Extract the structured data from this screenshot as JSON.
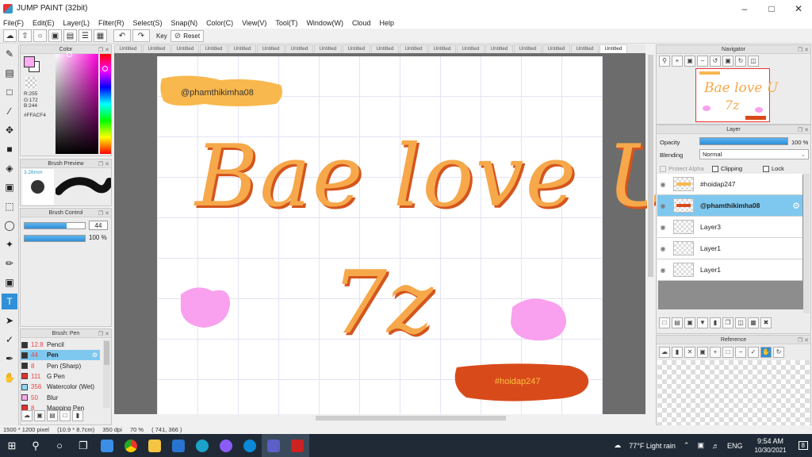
{
  "app": {
    "title": "JUMP PAINT (32bit)"
  },
  "menu": [
    "File(F)",
    "Edit(E)",
    "Layer(L)",
    "Filter(R)",
    "Select(S)",
    "Snap(N)",
    "Color(C)",
    "View(V)",
    "Tool(T)",
    "Window(W)",
    "Cloud",
    "Help"
  ],
  "toolbar": {
    "key_label": "Key",
    "reset_label": "Reset"
  },
  "panels": {
    "color": "Color",
    "brush_preview": "Brush Preview",
    "brush_control": "Brush Control",
    "brush": "Brush: Pen",
    "navigator": "Navigator",
    "layer": "Layer",
    "reference": "Reference"
  },
  "color": {
    "r": "R:255",
    "g": "G:172",
    "b": "B:244",
    "hex": "#FFACF4",
    "fg_color": "#FFACF4"
  },
  "brush_preview": {
    "size": "3.26mm"
  },
  "brush_control": {
    "size": "44",
    "opacity": "100 %",
    "size_fraction": 0.7,
    "opacity_fraction": 1.0
  },
  "brushes": [
    {
      "num": "12.8",
      "name": "Pencil",
      "color": "#333333"
    },
    {
      "num": "44",
      "name": "Pen",
      "color": "#333333",
      "selected": true
    },
    {
      "num": "8",
      "name": "Pen (Sharp)",
      "color": "#333333"
    },
    {
      "num": "111",
      "name": "G Pen",
      "color": "#e03030"
    },
    {
      "num": "356",
      "name": "Watercolor (Wet)",
      "color": "#8ed6f5"
    },
    {
      "num": "50",
      "name": "Blur",
      "color": "#f7a8e6"
    },
    {
      "num": "8",
      "name": "Mapping Pen",
      "color": "#e03030"
    }
  ],
  "doc_tabs": [
    "Untitled",
    "Untitled",
    "Untitled",
    "Untitled",
    "Untitled",
    "Untitled",
    "Untitled",
    "Untitled",
    "Untitled",
    "Untitled",
    "Untitled",
    "Untitled",
    "Untitled",
    "Untitled",
    "Untitled",
    "Untitled",
    "Untitled",
    "Untitled"
  ],
  "canvas": {
    "tag_top": "@phamthikimha08",
    "line1": "Bae love U",
    "line2": "7z",
    "tag_bottom": "#hoidap247"
  },
  "layer": {
    "opacity_label": "Opacity",
    "opacity_value": "100 %",
    "blending_label": "Blending",
    "blending_value": "Normal",
    "protect_alpha": "Protect Alpha",
    "clipping": "Clipping",
    "lock": "Lock",
    "layers": [
      {
        "name": "#hoidap247",
        "selected": false
      },
      {
        "name": "@phamthikimha08",
        "selected": true
      },
      {
        "name": "Layer3",
        "selected": false
      },
      {
        "name": "Layer1",
        "selected": false
      },
      {
        "name": "Layer1",
        "selected": false
      }
    ]
  },
  "status": {
    "size": "1500 * 1200 pixel",
    "phys": "(10.9 * 8.7cm)",
    "dpi": "350 dpi",
    "zoom": "70 %",
    "coords": "( 741, 366 )"
  },
  "taskbar": {
    "weather": "77°F  Light rain",
    "lang": "ENG",
    "time": "9:54 AM",
    "date": "10/30/2021",
    "notif": "8"
  }
}
